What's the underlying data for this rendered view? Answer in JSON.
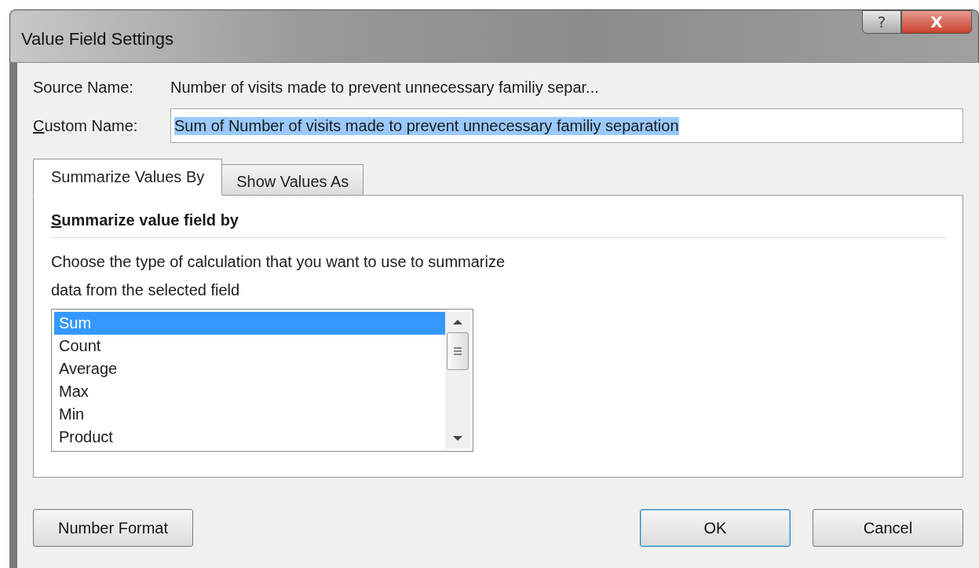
{
  "window": {
    "title": "Value Field Settings",
    "help_button": "?",
    "close_button": "X"
  },
  "source_name": {
    "label": "Source Name:",
    "value": "Number of visits made to prevent unnecessary familiy separ..."
  },
  "custom_name": {
    "label": "Custom Name:",
    "value": "Sum of Number of visits made to prevent unnecessary familiy separation",
    "text_selected": true
  },
  "tabs": [
    {
      "label": "Summarize Values By",
      "selected": true
    },
    {
      "label": "Show Values As",
      "selected": false
    }
  ],
  "panel": {
    "heading": "Summarize value field by",
    "description_lines": [
      "Choose the type of calculation that you want to use to summarize",
      "data from the selected field"
    ],
    "list": [
      {
        "label": "Sum",
        "selected": true
      },
      {
        "label": "Count",
        "selected": false
      },
      {
        "label": "Average",
        "selected": false
      },
      {
        "label": "Max",
        "selected": false
      },
      {
        "label": "Min",
        "selected": false
      },
      {
        "label": "Product",
        "selected": false
      }
    ]
  },
  "buttons": [
    {
      "label": "Number Format",
      "kind": "secondary"
    },
    {
      "label": "OK",
      "kind": "default"
    },
    {
      "label": "Cancel",
      "kind": "normal"
    }
  ]
}
